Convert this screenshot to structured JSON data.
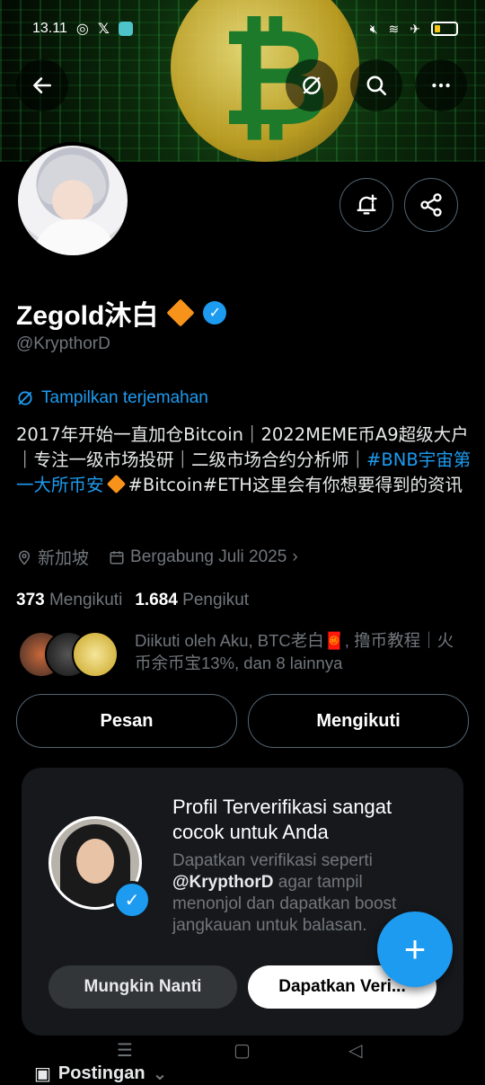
{
  "status_bar": {
    "time": "13.11",
    "apps": [
      "whatsapp-icon",
      "x-icon",
      "app-icon"
    ]
  },
  "header": {
    "back_icon": "arrow-left-icon",
    "translate_icon": "translate-icon",
    "search_icon": "search-icon",
    "more_icon": "more-icon",
    "banner_symbol": "₿"
  },
  "profile": {
    "name": "Zegold沐白",
    "handle": "@KrypthorD",
    "translate_label": "Tampilkan terjemahan",
    "bio_part1": "2017年开始一直加仓Bitcoin｜2022MEME币A9超级大户｜专注一级市场投研｜二级市场合约分析师｜",
    "bio_tag": "#BNB宇宙第一大所币安",
    "bio_part2": "#Bitcoin#ETH这里会有你想要得到的资讯",
    "location": "新加坡",
    "joined": "Bergabung Juli 2025",
    "following_count": "373",
    "following_label": "Mengikuti",
    "followers_count": "1.684",
    "followers_label": "Pengikut",
    "followed_by": "Diikuti oleh Aku, BTC老白🧧, 撸币教程｜火币余币宝13%, dan 8 lainnya"
  },
  "actions": {
    "message": "Pesan",
    "following": "Mengikuti"
  },
  "promo_card": {
    "title": "Profil Terverifikasi sangat cocok untuk Anda",
    "desc_before": "Dapatkan verifikasi seperti ",
    "desc_handle": "@KrypthorD",
    "desc_after": " agar tampil menonjol dan dapatkan boost jangkauan untuk balasan.",
    "later": "Mungkin Nanti",
    "get": "Dapatkan Veri..."
  },
  "tabs": {
    "posts": "Postingan"
  },
  "colors": {
    "accent": "#1d9bf0",
    "muted": "#71767b",
    "bitcoin": "#f7931a"
  }
}
